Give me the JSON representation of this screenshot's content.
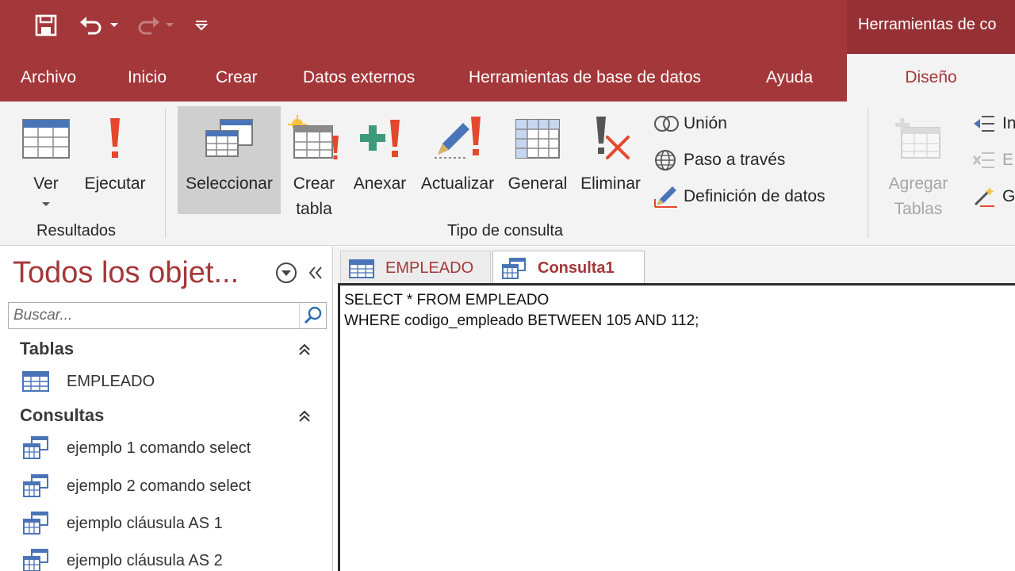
{
  "titlebar": {
    "context_title": "Herramientas de co",
    "qat": [
      "save-icon",
      "undo-icon",
      "redo-icon",
      "customize-qat-icon"
    ]
  },
  "tabs": [
    "Archivo",
    "Inicio",
    "Crear",
    "Datos externos",
    "Herramientas de base de datos",
    "Ayuda",
    "Diseño"
  ],
  "active_tab": "Diseño",
  "ribbon": {
    "results_group": {
      "label": "Resultados",
      "ver": "Ver",
      "ejecutar": "Ejecutar"
    },
    "query_type_group": {
      "label": "Tipo de consulta",
      "seleccionar": "Seleccionar",
      "crear_tabla_1": "Crear",
      "crear_tabla_2": "tabla",
      "anexar": "Anexar",
      "actualizar": "Actualizar",
      "general": "General",
      "eliminar": "Eliminar",
      "union": "Unión",
      "paso_a_traves": "Paso a través",
      "definicion_datos": "Definición de datos"
    },
    "setup_group": {
      "agregar_1": "Agregar",
      "agregar_2": "Tablas",
      "insert_partial": "In",
      "delete_partial": "E",
      "builder_partial": "G"
    }
  },
  "nav": {
    "title": "Todos los objet...",
    "search_placeholder": "Buscar...",
    "tables_header": "Tablas",
    "tables": [
      "EMPLEADO"
    ],
    "queries_header": "Consultas",
    "queries": [
      "ejemplo 1 comando select",
      "ejemplo 2 comando select",
      "ejemplo cláusula AS 1",
      "ejemplo cláusula AS 2"
    ]
  },
  "doc": {
    "tabs": [
      "EMPLEADO",
      "Consulta1"
    ],
    "active_tab": "Consulta1",
    "sql_lines": [
      "SELECT * FROM EMPLEADO",
      "WHERE codigo_empleado BETWEEN 105 AND 112;"
    ]
  },
  "colors": {
    "brand": "#a4373a",
    "ribbon_bg": "#f3f3f3",
    "selected_button": "#cfcfcf"
  }
}
